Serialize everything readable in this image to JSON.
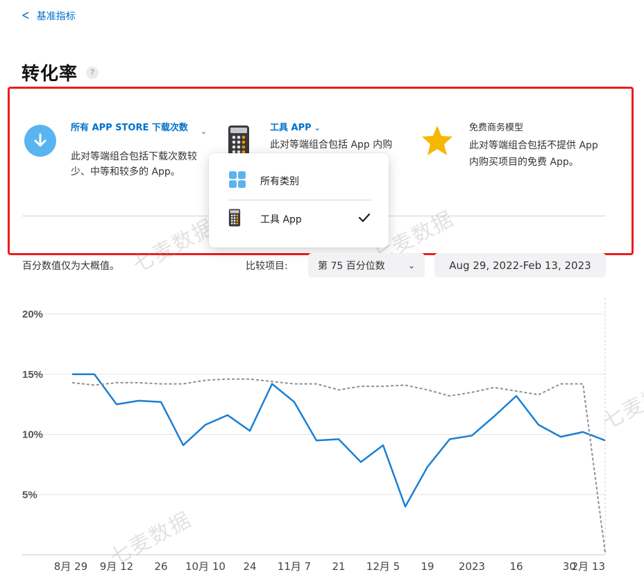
{
  "nav": {
    "back_label": "基准指标"
  },
  "page": {
    "title": "转化率",
    "help_glyph": "?"
  },
  "cards": [
    {
      "icon": "download-icon",
      "title": "所有 APP STORE 下载次数",
      "description": "此对等端组合包括下载次数较少、中等和较多的 App。",
      "color": "#5ab4f0"
    },
    {
      "icon": "calculator-icon",
      "title": "工具 APP",
      "description": "此对等端组合包括 App 内购买项目的"
    },
    {
      "icon": "star-icon",
      "title": "免费商务模型",
      "description": "此对等端组合包括不提供 App 内购买项目的免费 App。",
      "color": "#f5b800"
    }
  ],
  "dropdown": {
    "items": [
      {
        "icon": "grid-icon",
        "label": "所有类别",
        "selected": false
      },
      {
        "icon": "calculator-icon",
        "label": "工具 App",
        "selected": true
      }
    ]
  },
  "controls": {
    "note": "百分数值仅为大概值。",
    "compare_label": "比较项目:",
    "compare_value": "第 75 百分位数",
    "date_range": "Aug 29, 2022-Feb 13, 2023"
  },
  "watermark_text": "七麦数据",
  "highlight_color": "#ee1b1b",
  "accent_color": "#0070c9",
  "chart_data": {
    "type": "line",
    "y_ticks": [
      "20%",
      "15%",
      "10%",
      "5%"
    ],
    "ylim": [
      0,
      20
    ],
    "x_tick_labels": [
      "8月 29",
      "9月 12",
      "26",
      "10月 10",
      "24",
      "11月 7",
      "21",
      "12月 5",
      "19",
      "2023",
      "16",
      "30",
      "2月 13"
    ],
    "x_dates": [
      "2022-08-29",
      "2022-09-05",
      "2022-09-12",
      "2022-09-19",
      "2022-09-26",
      "2022-10-03",
      "2022-10-10",
      "2022-10-17",
      "2022-10-24",
      "2022-10-31",
      "2022-11-07",
      "2022-11-14",
      "2022-11-21",
      "2022-11-28",
      "2022-12-05",
      "2022-12-12",
      "2022-12-19",
      "2022-12-26",
      "2023-01-02",
      "2023-01-09",
      "2023-01-16",
      "2023-01-23",
      "2023-01-30",
      "2023-02-06",
      "2023-02-13"
    ],
    "grid": true,
    "series": [
      {
        "style": "solid",
        "color": "#1a7fd4",
        "values": [
          15.0,
          15.0,
          12.5,
          12.8,
          12.7,
          9.1,
          10.8,
          11.6,
          10.3,
          14.2,
          12.7,
          9.5,
          9.6,
          7.7,
          9.1,
          4.0,
          7.3,
          9.6,
          9.9,
          11.5,
          13.2,
          10.8,
          9.8,
          10.2,
          9.5
        ]
      },
      {
        "style": "dashed",
        "color": "#8e8e93",
        "values": [
          14.3,
          14.1,
          14.3,
          14.3,
          14.2,
          14.2,
          14.5,
          14.6,
          14.6,
          14.4,
          14.2,
          14.2,
          13.7,
          14.0,
          14.0,
          14.1,
          13.7,
          13.2,
          13.5,
          13.9,
          13.6,
          13.3,
          14.2,
          14.2,
          0.2
        ]
      }
    ]
  }
}
